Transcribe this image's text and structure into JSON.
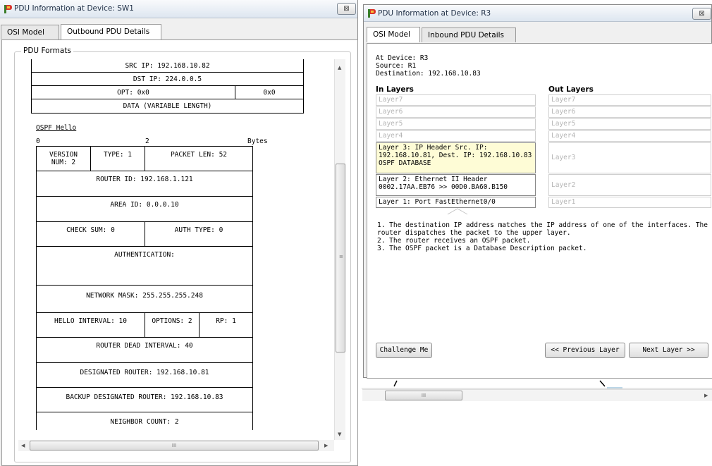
{
  "left_window": {
    "title": "PDU Information at Device: SW1",
    "close_glyph": "⊠",
    "tabs": [
      "OSI Model",
      "Outbound PDU Details"
    ],
    "active_tab": 1,
    "group_label": "PDU Formats",
    "ip_header": {
      "src_ip": "SRC IP: 192.168.10.82",
      "dst_ip": "DST IP: 224.0.0.5",
      "opt": "OPT: 0x0",
      "opt_pad": "0x0",
      "data": "DATA (VARIABLE LENGTH)"
    },
    "ospf": {
      "title": "OSPF Hello",
      "byte_0": "0",
      "byte_2": "2",
      "bytes_label": "Bytes",
      "version": "VERSION NUM: 2",
      "type": "TYPE: 1",
      "packet_len": "PACKET LEN: 52",
      "router_id": "ROUTER ID: 192.168.1.121",
      "area_id": "AREA ID: 0.0.0.10",
      "check_sum": "CHECK SUM: 0",
      "auth_type": "AUTH TYPE: 0",
      "authentication": "AUTHENTICATION:",
      "network_mask": "NETWORK MASK: 255.255.255.248",
      "hello_interval": "HELLO INTERVAL: 10",
      "options": "OPTIONS: 2",
      "rp": "RP: 1",
      "router_dead_interval": "ROUTER DEAD INTERVAL: 40",
      "designated_router": "DESIGNATED ROUTER: 192.168.10.81",
      "backup_designated_router": "BACKUP DESIGNATED ROUTER: 192.168.10.83",
      "neighbor_count": "NEIGHBOR COUNT: 2"
    },
    "hscroll_grip": "III",
    "vscroll_grip": "≡"
  },
  "right_window": {
    "title": "PDU Information at Device: R3",
    "close_glyph": "⊠",
    "tabs": [
      "OSI Model",
      "Inbound PDU Details"
    ],
    "active_tab": 0,
    "at_device": "At Device: R3",
    "source": "Source: R1",
    "destination": "Destination: 192.168.10.83",
    "in_layers_heading": "In Layers",
    "out_layers_heading": "Out Layers",
    "in_layers": {
      "l7": "Layer7",
      "l6": "Layer6",
      "l5": "Layer5",
      "l4": "Layer4",
      "l3": "Layer 3: IP Header Src. IP: 192.168.10.81, Dest. IP: 192.168.10.83 OSPF DATABASE",
      "l2": "Layer 2: Ethernet II Header 0002.17AA.EB76 >> 00D0.BA60.B150",
      "l1": "Layer 1: Port FastEthernet0/0"
    },
    "out_layers": {
      "l7": "Layer7",
      "l6": "Layer6",
      "l5": "Layer5",
      "l4": "Layer4",
      "l3": "Layer3",
      "l2": "Layer2",
      "l1": "Layer1"
    },
    "explanations": [
      "1. The destination IP address matches the IP address of one of the interfaces. The router dispatches the packet to the upper layer.",
      "2. The router receives an OSPF packet.",
      "3. The OSPF packet is a Database Description packet."
    ],
    "challenge_button": "Challenge Me",
    "prev_button": "<< Previous Layer",
    "next_button": "Next Layer >>"
  },
  "background_scrollbar": {
    "grip": "III"
  }
}
